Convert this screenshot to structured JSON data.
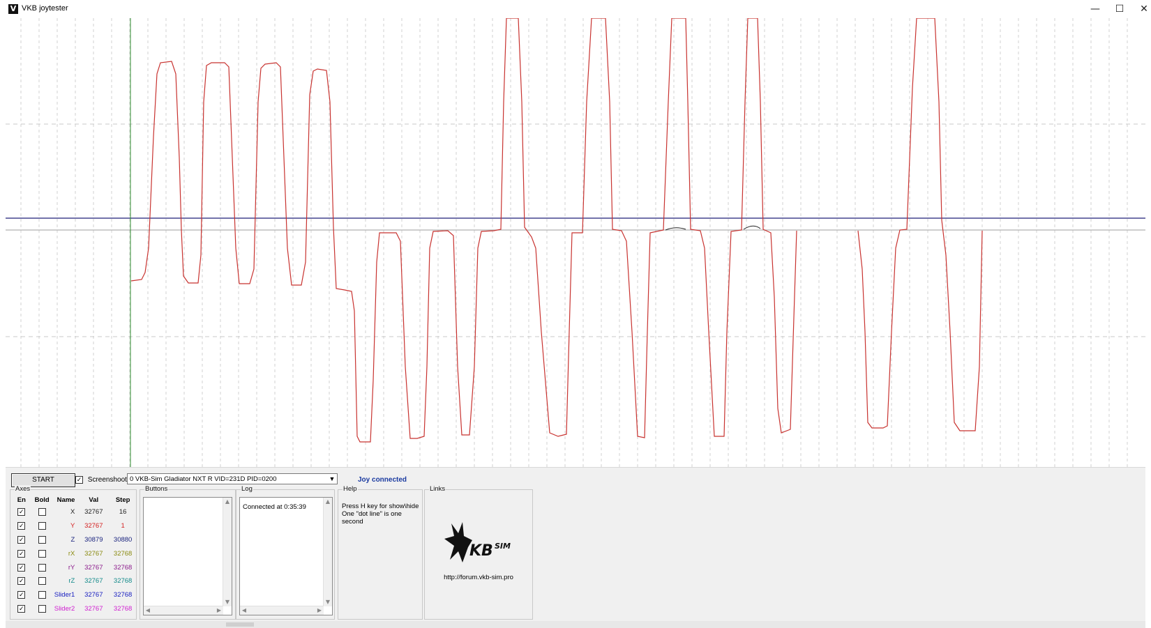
{
  "window": {
    "title": "VKB joytester",
    "icon": "vkb-app-icon",
    "controls": [
      "minimize-icon",
      "maximize-icon",
      "close-icon"
    ]
  },
  "plot": {
    "background": "#ffffff",
    "trace_color": "#c8322f",
    "center_line_color": "#1e1e78",
    "cursor_line_color": "#2e8b2e",
    "grid_color": "#c8c8c8"
  },
  "toolbar": {
    "start_label": "START",
    "screenshot_label": "Screenshoot",
    "screenshot_checked": true,
    "device_selected": "0  VKB-Sim Gladiator NXT R   VID=231D PID=0200",
    "status": "Joy connected"
  },
  "axes_panel": {
    "title": "Axes",
    "headers": {
      "en": "En",
      "bold": "Bold",
      "name": "Name",
      "val": "Val",
      "step": "Step"
    },
    "rows": [
      {
        "name": "X",
        "val": "32767",
        "step": "16",
        "color": "#222222",
        "enabled": true,
        "bold": false
      },
      {
        "name": "Y",
        "val": "32767",
        "step": "1",
        "color": "#d42020",
        "enabled": true,
        "bold": false
      },
      {
        "name": "Z",
        "val": "30879",
        "step": "30880",
        "color": "#1a237e",
        "enabled": true,
        "bold": false
      },
      {
        "name": "rX",
        "val": "32767",
        "step": "32768",
        "color": "#8a8a10",
        "enabled": true,
        "bold": false
      },
      {
        "name": "rY",
        "val": "32767",
        "step": "32768",
        "color": "#8b1a8b",
        "enabled": true,
        "bold": false
      },
      {
        "name": "rZ",
        "val": "32767",
        "step": "32768",
        "color": "#128a8a",
        "enabled": true,
        "bold": false
      },
      {
        "name": "Slider1",
        "val": "32767",
        "step": "32768",
        "color": "#1a20c0",
        "enabled": true,
        "bold": false
      },
      {
        "name": "Slider2",
        "val": "32767",
        "step": "32768",
        "color": "#d020d0",
        "enabled": true,
        "bold": false
      }
    ]
  },
  "buttons_panel": {
    "title": "Buttons"
  },
  "log_panel": {
    "title": "Log",
    "lines": [
      "Connected at 0:35:39"
    ]
  },
  "help_panel": {
    "title": "Help",
    "line1": "Press H key for show\\hide",
    "line2": "One \"dot line\" is one second"
  },
  "links_panel": {
    "title": "Links",
    "logo": "vkbsim-logo",
    "url": "http://forum.vkb-sim.pro"
  }
}
